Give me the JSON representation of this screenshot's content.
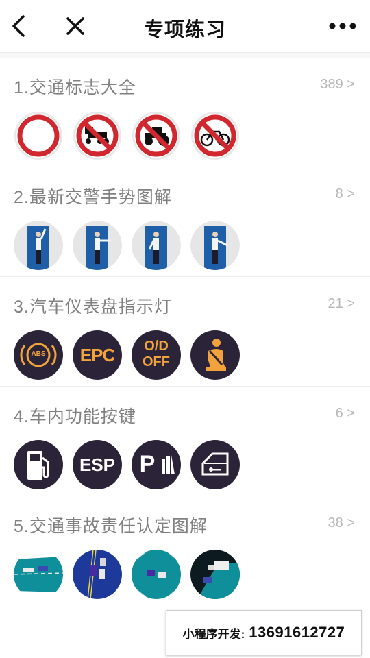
{
  "navbar": {
    "title": "专项练习",
    "back_icon": "chevron-left-icon",
    "close_icon": "close-icon",
    "more_icon": "more-dots-icon"
  },
  "sections": [
    {
      "title": "1.交通标志大全",
      "count": "389 >",
      "icons": [
        "no-entry-sign-icon",
        "no-tricycle-sign-icon",
        "no-tractor-sign-icon",
        "no-bicycle-sign-icon"
      ]
    },
    {
      "title": "2.最新交警手势图解",
      "count": "8 >",
      "icons": [
        "police-stop-gesture-icon",
        "police-straight-gesture-icon",
        "police-left-turn-gesture-icon",
        "police-right-turn-gesture-icon"
      ]
    },
    {
      "title": "3.汽车仪表盘指示灯",
      "count": "21 >",
      "icons": [
        "abs-warning-icon",
        "epc-warning-icon",
        "od-off-icon",
        "seatbelt-warning-icon"
      ],
      "labels": {
        "abs": "ABS",
        "epc": "EPC",
        "od": "O/D",
        "off": "OFF"
      }
    },
    {
      "title": "4.车内功能按键",
      "count": "6 >",
      "icons": [
        "fuel-pump-icon",
        "esp-button-icon",
        "parking-sensor-icon",
        "door-lock-icon"
      ],
      "labels": {
        "esp": "ESP",
        "p": "P"
      }
    },
    {
      "title": "5.交通事故责任认定图解",
      "count": "38 >",
      "icons": [
        "accident-scene-1-icon",
        "accident-scene-2-icon",
        "accident-scene-3-icon",
        "accident-scene-4-icon"
      ]
    }
  ],
  "watermark": {
    "label": "小程序开发:",
    "phone": "13691612727"
  },
  "colors": {
    "sign_red": "#d0282e",
    "dashboard_bg": "#2b2337",
    "dashboard_amber": "#f2a33c",
    "police_blue": "#1f5fa8",
    "road_teal": "#0f8f9a"
  }
}
